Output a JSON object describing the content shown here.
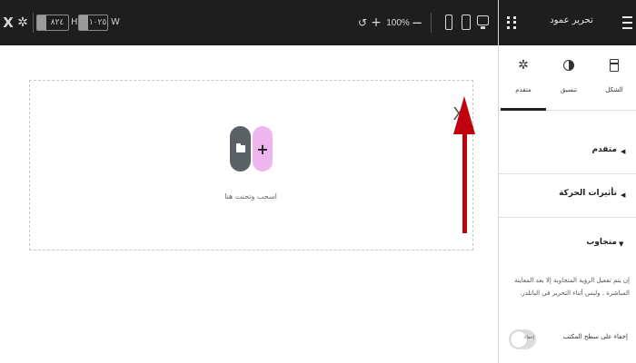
{
  "toolbar": {
    "close_glyph": "X",
    "width_label": "W",
    "width_value": "١٠٢٥",
    "height_label": "H",
    "height_value": "٨٢٤",
    "undo_glyph": "↺",
    "zoom_in_glyph": "+",
    "zoom_level": "100%",
    "zoom_out_glyph": "−",
    "devices": [
      "mobile",
      "tablet",
      "desktop"
    ]
  },
  "canvas": {
    "drop_hint": "اسحب وتحنت هنا",
    "add_glyph": "+",
    "close_glyph": "X"
  },
  "panel": {
    "title": "تحرير عمود",
    "tabs": [
      {
        "label": "الشكل",
        "icon": "layout-icon"
      },
      {
        "label": "تنسيق",
        "icon": "style-icon"
      },
      {
        "label": "متقدم",
        "icon": "gear-icon",
        "active": true
      }
    ],
    "sections": [
      {
        "title": "متقدم"
      },
      {
        "title": "تأثيرات الحركة"
      }
    ],
    "responsive": {
      "title": "متجاوب",
      "description": "إن يتم تفعيل الرؤية المتجاوبة إلا بعد المعاينة المباشرة ، وليس أثناء التحرير في الباتلدر.",
      "hide_desktop_label": "إخفاء على سطح المكتب",
      "toggle_text": "إخفاء"
    }
  },
  "colors": {
    "toolbar_bg": "#1e1e1e",
    "add_button": "#efb5ef",
    "folder_button": "#5b5f66",
    "annotation_arrow": "#c0000c"
  }
}
